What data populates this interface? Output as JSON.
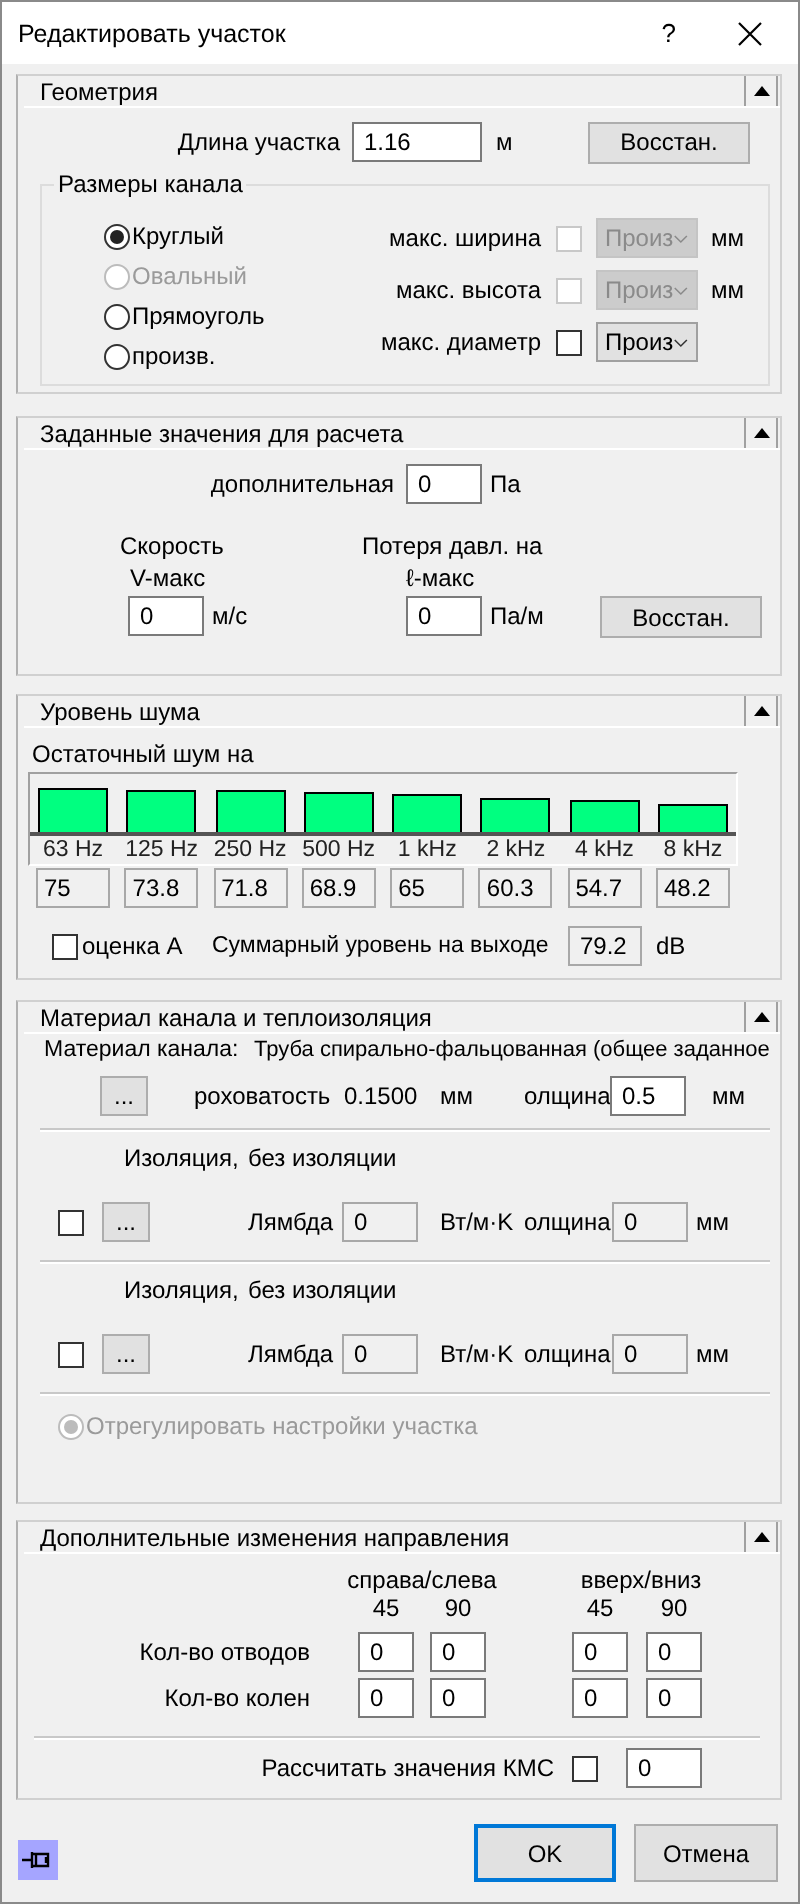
{
  "window": {
    "title": "Редактировать участок",
    "help": "?"
  },
  "geometry": {
    "title": "Геометрия",
    "length_label": "Длина участка",
    "length_value": "1.16",
    "length_unit": "м",
    "restore_button": "Восстан.",
    "duct_size": {
      "title": "Размеры канала",
      "shapes": [
        {
          "label": "Круглый",
          "selected": true,
          "disabled": false
        },
        {
          "label": "Овальный",
          "selected": false,
          "disabled": true
        },
        {
          "label": "Прямоуголь",
          "selected": false,
          "disabled": false
        },
        {
          "label": "произв.",
          "selected": false,
          "disabled": false
        }
      ],
      "limits": [
        {
          "label": "макс. ширина",
          "checked": false,
          "disabled": true,
          "option": "Произ",
          "unit": "мм"
        },
        {
          "label": "макс. высота",
          "checked": false,
          "disabled": true,
          "option": "Произ",
          "unit": "мм"
        },
        {
          "label": "макс. диаметр",
          "checked": false,
          "disabled": false,
          "option": "Произ"
        }
      ]
    }
  },
  "design_values": {
    "title": "Заданные значения для расчета",
    "additional_label": "дополнительная",
    "additional_value": "0",
    "additional_unit": "Па",
    "velocity_label": "Скорость",
    "velocity_sub": "V-макс",
    "velocity_value": "0",
    "velocity_unit": "м/с",
    "pressure_label": "Потеря давл. на",
    "pressure_sub": "ℓ-макс",
    "pressure_value": "0",
    "pressure_unit": "Па/м",
    "restore_button": "Восстан."
  },
  "noise": {
    "title": "Уровень шума",
    "residual_label": "Остаточный шум на",
    "bands": [
      {
        "label": "63 Hz",
        "value": "75"
      },
      {
        "label": "125 Hz",
        "value": "73.8"
      },
      {
        "label": "250 Hz",
        "value": "71.8"
      },
      {
        "label": "500 Hz",
        "value": "68.9"
      },
      {
        "label": "1 kHz",
        "value": "65"
      },
      {
        "label": "2 kHz",
        "value": "60.3"
      },
      {
        "label": "4 kHz",
        "value": "54.7"
      },
      {
        "label": "8 kHz",
        "value": "48.2"
      }
    ],
    "a_weighting": {
      "label": "оценка A",
      "checked": false
    },
    "total_label": "Суммарный уровень на выходе",
    "total_value": "79.2",
    "total_unit": "dB"
  },
  "material": {
    "title": "Материал канала и теплоизоляция",
    "material_label": "Материал канала:",
    "material_value": "Труба спирально-фальцованная (общее заданное",
    "browse_button": "...",
    "roughness_label": "роховатость",
    "roughness_value": "0.1500",
    "roughness_unit": "мм",
    "thickness_label": "олщина",
    "thickness_value": "0.5",
    "thickness_unit": "мм",
    "insulations": [
      {
        "label": "Изоляция,",
        "value": "без изоляции",
        "checked": false,
        "browse_button": "...",
        "lambda_label": "Лямбда",
        "lambda_value": "0",
        "lambda_unit": "Вт/м·K",
        "thickness_label": "олщина",
        "thickness_value": "0",
        "thickness_unit": "мм"
      },
      {
        "label": "Изоляция,",
        "value": "без изоляции",
        "checked": false,
        "browse_button": "...",
        "lambda_label": "Лямбда",
        "lambda_value": "0",
        "lambda_unit": "Вт/м·K",
        "thickness_label": "олщина",
        "thickness_value": "0",
        "thickness_unit": "мм"
      }
    ],
    "adjust": {
      "label": "Отрегулировать настройки участка",
      "selected": true,
      "disabled": true
    }
  },
  "directions": {
    "title": "Дополнительные изменения направления",
    "groups": [
      {
        "label": "справа/слева",
        "angles": [
          "45",
          "90"
        ]
      },
      {
        "label": "вверх/вниз",
        "angles": [
          "45",
          "90"
        ]
      }
    ],
    "rows": [
      {
        "label": "Кол-во отводов",
        "values": [
          "0",
          "0",
          "0",
          "0"
        ]
      },
      {
        "label": "Кол-во колен",
        "values": [
          "0",
          "0",
          "0",
          "0"
        ]
      }
    ],
    "kms": {
      "label": "Рассчитать значения КМС",
      "checked": false,
      "value": "0"
    }
  },
  "footer": {
    "ok_button": "OK",
    "cancel_button": "Отмена"
  }
}
